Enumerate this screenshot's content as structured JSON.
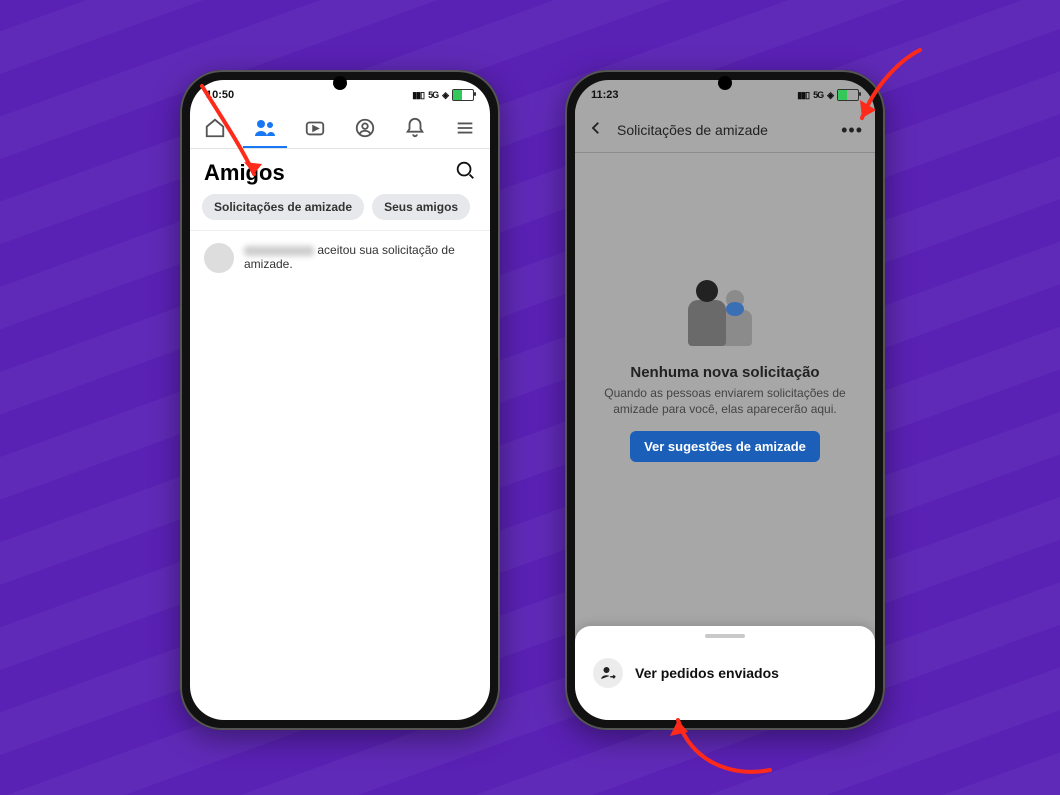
{
  "screen1": {
    "status": {
      "time": "10:50",
      "net": "5G"
    },
    "page_title": "Amigos",
    "chips": {
      "requests": "Solicitações de amizade",
      "your_friends": "Seus amigos"
    },
    "feed_accept_suffix": "aceitou sua solicitação de amizade."
  },
  "screen2": {
    "status": {
      "time": "11:23",
      "net": "5G"
    },
    "header_title": "Solicitações de amizade",
    "empty_title": "Nenhuma nova solicitação",
    "empty_body": "Quando as pessoas enviarem solicitações de amizade para você, elas aparecerão aqui.",
    "suggestions_btn": "Ver sugestões de amizade",
    "sheet_item": "Ver pedidos enviados"
  }
}
